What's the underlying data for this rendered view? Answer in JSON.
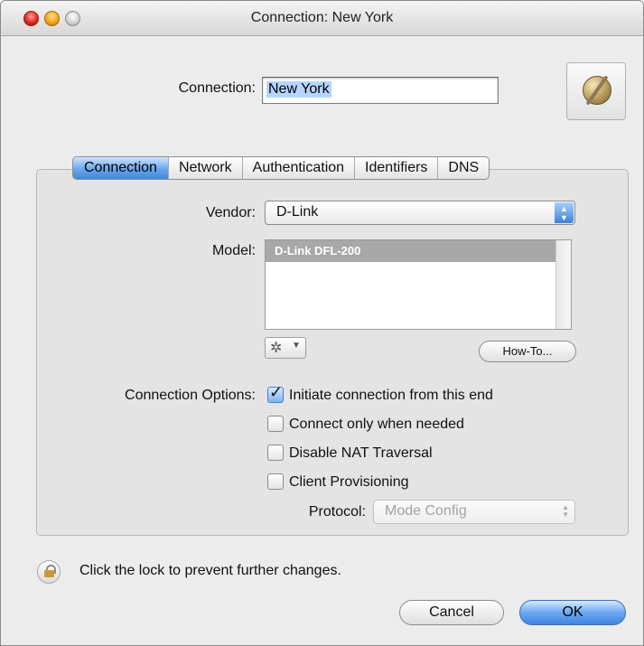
{
  "window": {
    "title": "Connection: New York"
  },
  "connection": {
    "label": "Connection:",
    "value": "New York"
  },
  "tabs": [
    {
      "label": "Connection",
      "active": true
    },
    {
      "label": "Network",
      "active": false
    },
    {
      "label": "Authentication",
      "active": false
    },
    {
      "label": "Identifiers",
      "active": false
    },
    {
      "label": "DNS",
      "active": false
    }
  ],
  "vendor": {
    "label": "Vendor:",
    "value": "D-Link"
  },
  "model": {
    "label": "Model:",
    "items": [
      "D-Link  DFL-200"
    ]
  },
  "buttons": {
    "howto": "How-To...",
    "cancel": "Cancel",
    "ok": "OK"
  },
  "options": {
    "label": "Connection Options:",
    "items": [
      {
        "label": "Initiate connection from this end",
        "checked": true
      },
      {
        "label": "Connect only when needed",
        "checked": false
      },
      {
        "label": "Disable NAT Traversal",
        "checked": false
      },
      {
        "label": "Client Provisioning",
        "checked": false
      }
    ]
  },
  "protocol": {
    "label": "Protocol:",
    "value": "Mode Config"
  },
  "lock": {
    "text": "Click the lock to prevent further changes."
  },
  "icons": {
    "app": "globe-icon",
    "gear": "gear-icon",
    "lock": "lock-icon"
  },
  "colors": {
    "accent": "#3f86db",
    "selection": "#a8a8a8"
  }
}
